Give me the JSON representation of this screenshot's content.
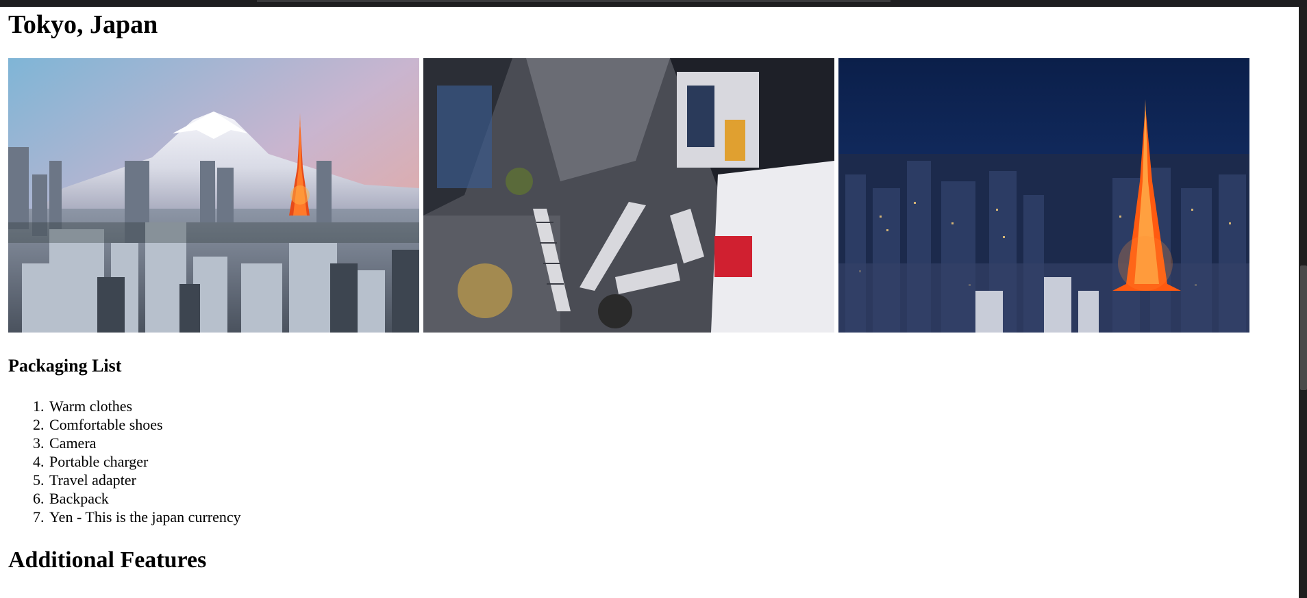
{
  "page": {
    "title": "Tokyo, Japan"
  },
  "gallery": {
    "images": [
      {
        "icon": "mount-fuji-tokyo-tower-skyline-photo"
      },
      {
        "icon": "shibuya-crossing-aerial-photo"
      },
      {
        "icon": "tokyo-tower-night-cityscape-photo"
      }
    ]
  },
  "packing": {
    "title": "Packaging List",
    "items": [
      {
        "num": "1.",
        "text": "Warm clothes"
      },
      {
        "num": "2.",
        "text": "Comfortable shoes"
      },
      {
        "num": "3.",
        "text": "Camera"
      },
      {
        "num": "4.",
        "text": "Portable charger"
      },
      {
        "num": "5.",
        "text": "Travel adapter"
      },
      {
        "num": "6.",
        "text": "Backpack"
      },
      {
        "num": "7.",
        "text": "Yen - This is the japan currency"
      }
    ]
  },
  "features": {
    "title": "Additional Features"
  },
  "colors": {
    "browser_chrome": "#1e1e20",
    "scrollbar_track": "#1f1f1f",
    "scrollbar_thumb": "#4a4a4a",
    "text": "#000000",
    "background": "#ffffff"
  }
}
